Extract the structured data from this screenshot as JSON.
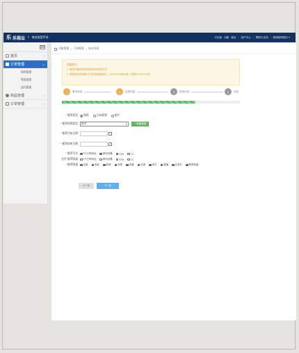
{
  "app": {
    "logo": "乐",
    "name": "乐视云",
    "sep": "•",
    "subtitle": "商业发型平台"
  },
  "topnav": [
    "中文版",
    "功能",
    "退出",
    "用户中心",
    "帮助与支持",
    "新闻官网提示 ▾"
  ],
  "sidebar": {
    "items": [
      {
        "label": "首页",
        "active": false
      },
      {
        "label": "订单管理",
        "active": true
      },
      {
        "label": "商品管理",
        "active": false
      },
      {
        "label": "订单管理",
        "active": false
      }
    ],
    "subitems": [
      "购物管理",
      "等级管理",
      "返利管理"
    ]
  },
  "breadcrumb": [
    "功能管理",
    "订单管理",
    "流水列表"
  ],
  "notice": {
    "title": "温馨提示：",
    "lines": [
      "1. 操作不能同时选择发布时间的方式",
      "2. 请您发布时间的方式在有效期进行，400-670-8888 转 1 选择5 9:00-18:00"
    ]
  },
  "steps": [
    {
      "num": "1",
      "label": "基本信息",
      "status": "done"
    },
    {
      "num": "2",
      "label": "选择流量",
      "status": "current"
    },
    {
      "num": "3",
      "label": "投放时间",
      "status": "todo"
    },
    {
      "num": "4",
      "label": "完成",
      "status": "todo"
    }
  ],
  "progress": 0.75,
  "form": {
    "type_label": "推荐类型",
    "type_options": [
      "视频",
      "已有视频",
      "图片"
    ],
    "type_selected": 0,
    "video_label": "推荐视频类型",
    "video_value": "新流",
    "add_button": "+ 新建视频",
    "start_label": "推荐开始日期",
    "end_label": "推荐结束日期",
    "platform_label": "推荐平台",
    "platform_options": [
      "PC已有网站",
      "移动设备",
      "PAD",
      "TV"
    ],
    "platform_checked": [
      true,
      true,
      true,
      false
    ],
    "channel_label": "推荐频道",
    "channel_row2_label": "文件 推荐频道",
    "channel_row2_options": [
      "PC已有网站",
      "移动设备",
      "PAD",
      "TV"
    ],
    "channel_options": [
      "全部",
      "电影",
      "新闻",
      "体育",
      "热播",
      "动漫",
      "综艺",
      "直播",
      "纪录片",
      "教育频道"
    ],
    "prev_button": "上一步",
    "next_button": "下一步"
  },
  "colors": {
    "topbar": "#13315f",
    "active": "#2a6fc9",
    "step_active": "#f0ad4e",
    "step_todo": "#999999",
    "progress": "#5cb85c",
    "next": "#5bb1f3"
  }
}
